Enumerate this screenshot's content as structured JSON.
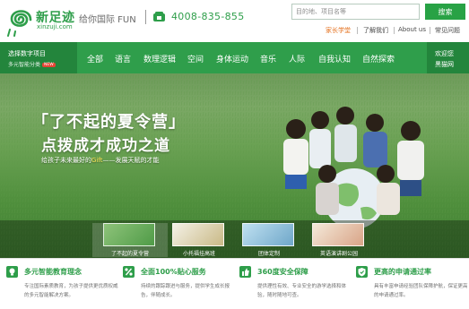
{
  "header": {
    "brand": "新足迹",
    "domain": "xinzuji.com",
    "slogan": "给你国际 FUN",
    "phone": "4008-835-855",
    "search_placeholder": "目的地、项目名等",
    "search_button": "搜索",
    "links": [
      "家长学堂",
      "了解我们",
      "About us",
      "常见问题"
    ]
  },
  "nav": {
    "select_line1": "选择数字项目",
    "select_line2": "多元智能分类",
    "new_badge": "NEW",
    "items": [
      "全部",
      "语言",
      "数理逻辑",
      "空间",
      "身体运动",
      "音乐",
      "人际",
      "自我认知",
      "自然探索"
    ],
    "right_line1": "欢迎您",
    "right_line2": "黑猫网"
  },
  "banner": {
    "headline": "「了不起的夏令营」",
    "subline": "点拨成才成功之道",
    "tagline_pre": "给孩子未来最好的",
    "tagline_highlight": "Gift",
    "tagline_post": "——发展天赋的才能",
    "thumbs": [
      "了不起的夏令营",
      "小托福挂高班",
      "团体定制",
      "英语演讲剧公园"
    ]
  },
  "features": [
    {
      "icon": "lightbulb-icon",
      "title": "多元智能教育理念",
      "desc": "专注国际素质教育，为孩子提供更优质权威的多元智能解决方案。"
    },
    {
      "icon": "percent-icon",
      "title": "全面100%贴心服务",
      "desc": "持续的跟踪跟进与服务，提供学生成长报告，伴随成长。"
    },
    {
      "icon": "thumbs-up-icon",
      "title": "360度安全保障",
      "desc": "提供理性有效、专业安全的游学选择和体验，随时随地可查。"
    },
    {
      "icon": "shield-icon",
      "title": "更高的申请通过率",
      "desc": "具有丰富申请经验团队保障护航，保证更高的申请通过率。"
    }
  ],
  "colors": {
    "primary": "#2f9e4b",
    "dark": "#23853c",
    "accent": "#e46f1b"
  }
}
